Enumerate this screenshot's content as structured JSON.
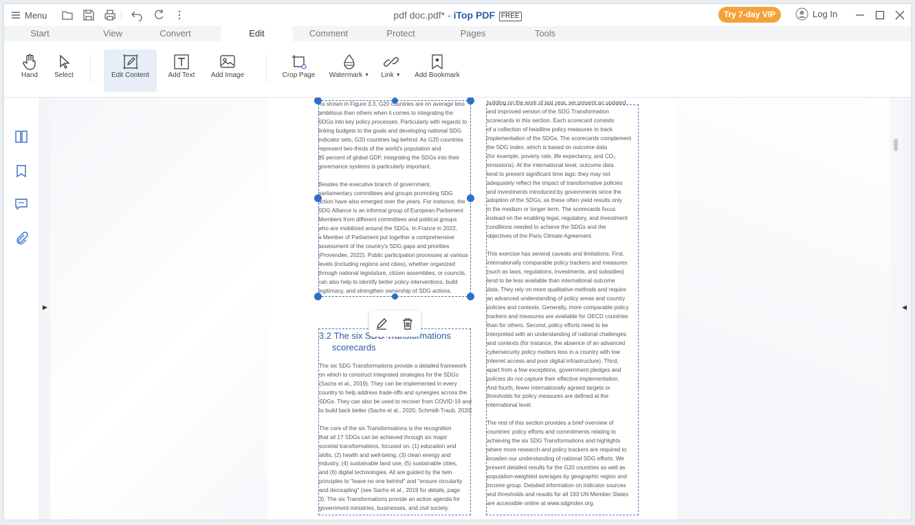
{
  "window": {
    "menu_label": "Menu",
    "title_file": "pdf doc.pdf* - ",
    "title_app": "iTop PDF",
    "title_badge": "FREE",
    "vip_label": "Try 7-day VIP",
    "login_label": "Log In"
  },
  "tabs": [
    "Start",
    "View",
    "Convert",
    "Edit",
    "Comment",
    "Protect",
    "Pages",
    "Tools"
  ],
  "active_tab": "Edit",
  "tools": {
    "hand": "Hand",
    "select": "Select",
    "edit_content": "Edit Content",
    "add_text": "Add Text",
    "add_image": "Add Image",
    "crop_page": "Crop Page",
    "watermark": "Watermark",
    "link": "Link",
    "add_bookmark": "Add Bookmark"
  },
  "document": {
    "left_col_top": [
      "As shown in Figure 3.3, G20 countries are on average less",
      "ambitious than others when it comes to integrating the",
      "SDGs into key policy processes. Particularly with regards to",
      "linking budgets to the goals and developing national SDG",
      "indicator sets, G20 countries lag behind. As G20 countries",
      "represent two-thirds of the world's population and",
      "85 percent of global GDP, integrating the SDGs into their",
      "governance systems is particularly important.",
      "",
      "Besides the executive branch of government,",
      "parliamentary committees and groups promoting SDG",
      "action have also emerged over the years. For instance, the",
      "SDG Alliance is an informal group of European Parliament",
      "Members from different committees and political groups",
      "who are mobilized around the SDGs. In France in 2022,",
      "a Member of Parliament put together a comprehensive",
      "assessment of the country's SDG gaps and priorities",
      "(Provendier, 2022). Public participation processes at various",
      "levels (including regions and cities), whether organized",
      "through national legislature, citizen assemblies, or councils,",
      "can also help to identify better policy interventions, build",
      "legitimacy, and strengthen ownership of SDG actions."
    ],
    "heading_line1": "3.2 The six SDG Transformations",
    "heading_line2": "scorecards",
    "left_col_bottom": [
      "The six SDG Transformations provide a detailed framework",
      "on which to construct integrated strategies for the SDGs",
      "(Sachs et al., 2019). They can be implemented in every",
      "country to help address trade-offs and synergies across the",
      "SDGs. They can also be used to recover from COVID-19 and",
      "to build back better (Sachs et al., 2020; Schmidt-Traub, 2020).",
      "",
      "The core of the six Transformations is the recognition",
      "that all 17 SDGs can be achieved through six major",
      "societal transformations, focused on: (1) education and",
      "skills, (2) health and well-being, (3) clean energy and",
      "industry, (4) sustainable land use, (5) sustainable cities,",
      "and (6) digital technologies. All are guided by the twin",
      "principles to \"leave no one behind\" and \"ensure circularity",
      "and decoupling\" (see Sachs et al., 2019 for details, page",
      "3). The six Transformations provide an action agenda for",
      "government ministries, businesses, and civil society."
    ],
    "right_col": [
      "building on the work of last year, we present an updated",
      "and improved version of the SDG Transformation",
      "scorecards in this section. Each scorecard consists",
      "of a collection of headline policy measures to track",
      "implementation of the SDGs. The scorecards complement",
      "the SDG Index, which is based on outcome data",
      "(for example, poverty rate, life expectancy, and CO₂",
      "emissions). At the international level, outcome data",
      "tend to present significant time lags: they may not",
      "adequately reflect the impact of transformative policies",
      "and investments introduced by governments since the",
      "adoption of the SDGs, as these often yield results only",
      "in the medium or longer term. The scorecards focus",
      "instead on the enabling legal, regulatory, and investment",
      "conditions needed to achieve the SDGs and the",
      "objectives of the Paris Climate Agreement.",
      "",
      "This exercise has several caveats and limitations. First,",
      "internationally comparable policy trackers and measures",
      "(such as laws, regulations, investments, and subsidies)",
      "tend to be less available than international outcome",
      "data. They rely on more qualitative methods and require",
      "an advanced understanding of policy areas and country",
      "policies and contexts. Generally, more comparable policy",
      "trackers and measures are available for OECD countries",
      "than for others. Second, policy efforts need to be",
      "interpreted with an understanding of national challenges",
      "and contexts (for instance, the absence of an advanced",
      "cybersecurity policy matters less in a country with low",
      "internet access and poor digital infrastructure). Third,",
      "apart from a few exceptions, government pledges and",
      "policies do not capture their effective implementation.",
      "And fourth, fewer internationally agreed targets or",
      "thresholds for policy measures are defined at the",
      "international level.",
      "",
      "The rest of this section provides a brief overview of",
      "countries' policy efforts and commitments relating to",
      "achieving the six SDG Transformations and highlights",
      "where more research and policy trackers are required to",
      "broaden our understanding of national SDG efforts. We",
      "present detailed results for the G20 countries as well as",
      "population-weighted averages by geographic region and",
      "income group. Detailed information on indicator sources",
      "and thresholds and results for all 193 UN Member States",
      "are accessible online at www.sdgindex.org."
    ]
  },
  "colors": {
    "accent": "#2f6ec6",
    "vip": "#f5a23a",
    "brand": "#2a5aa8"
  },
  "icons": [
    "menu-icon",
    "folder-icon",
    "save-icon",
    "print-icon",
    "undo-icon",
    "redo-icon",
    "more-icon",
    "user-icon",
    "minimize-icon",
    "maximize-icon",
    "close-icon",
    "hand-icon",
    "select-icon",
    "edit-content-icon",
    "add-text-icon",
    "add-image-icon",
    "crop-page-icon",
    "watermark-icon",
    "link-icon",
    "bookmark-icon",
    "thumbnails-icon",
    "bookmarks-panel-icon",
    "comments-panel-icon",
    "attachments-icon",
    "pencil-icon",
    "trash-icon"
  ]
}
